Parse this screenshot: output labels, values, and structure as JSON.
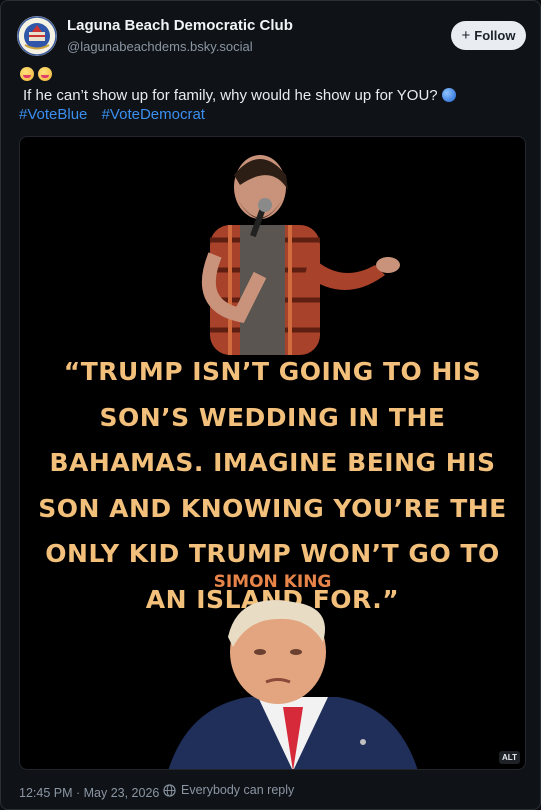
{
  "post": {
    "author_name": "Laguna Beach Democratic Club",
    "author_handle": "@lagunabeachdems.bsky.social",
    "follow_label": "Follow",
    "text": "If he can’t show up for family, why would he show up for YOU?",
    "hashtags": [
      "#VoteBlue",
      "#VoteDemocrat"
    ],
    "timestamp": "12:45 PM · May 23, 2026",
    "reply_setting": "Everybody can reply"
  },
  "image": {
    "quote": "“Trump isn’t going to his son’s wedding in the Bahamas. Imagine being his son and knowing you’re the only kid Trump won’t go to an island for.”",
    "quote_author": "Simon King",
    "alt_badge": "ALT"
  },
  "colors": {
    "background": "#0f1216",
    "link": "#3b8ff0",
    "quote_text": "#f3c07b",
    "quote_author": "#e6844a",
    "follow_button": "#e9edf2"
  },
  "icons": [
    "avatar-logo",
    "laughing-emoji",
    "silly-emoji",
    "blue-circle-emoji",
    "plus-icon",
    "globe-icon"
  ]
}
